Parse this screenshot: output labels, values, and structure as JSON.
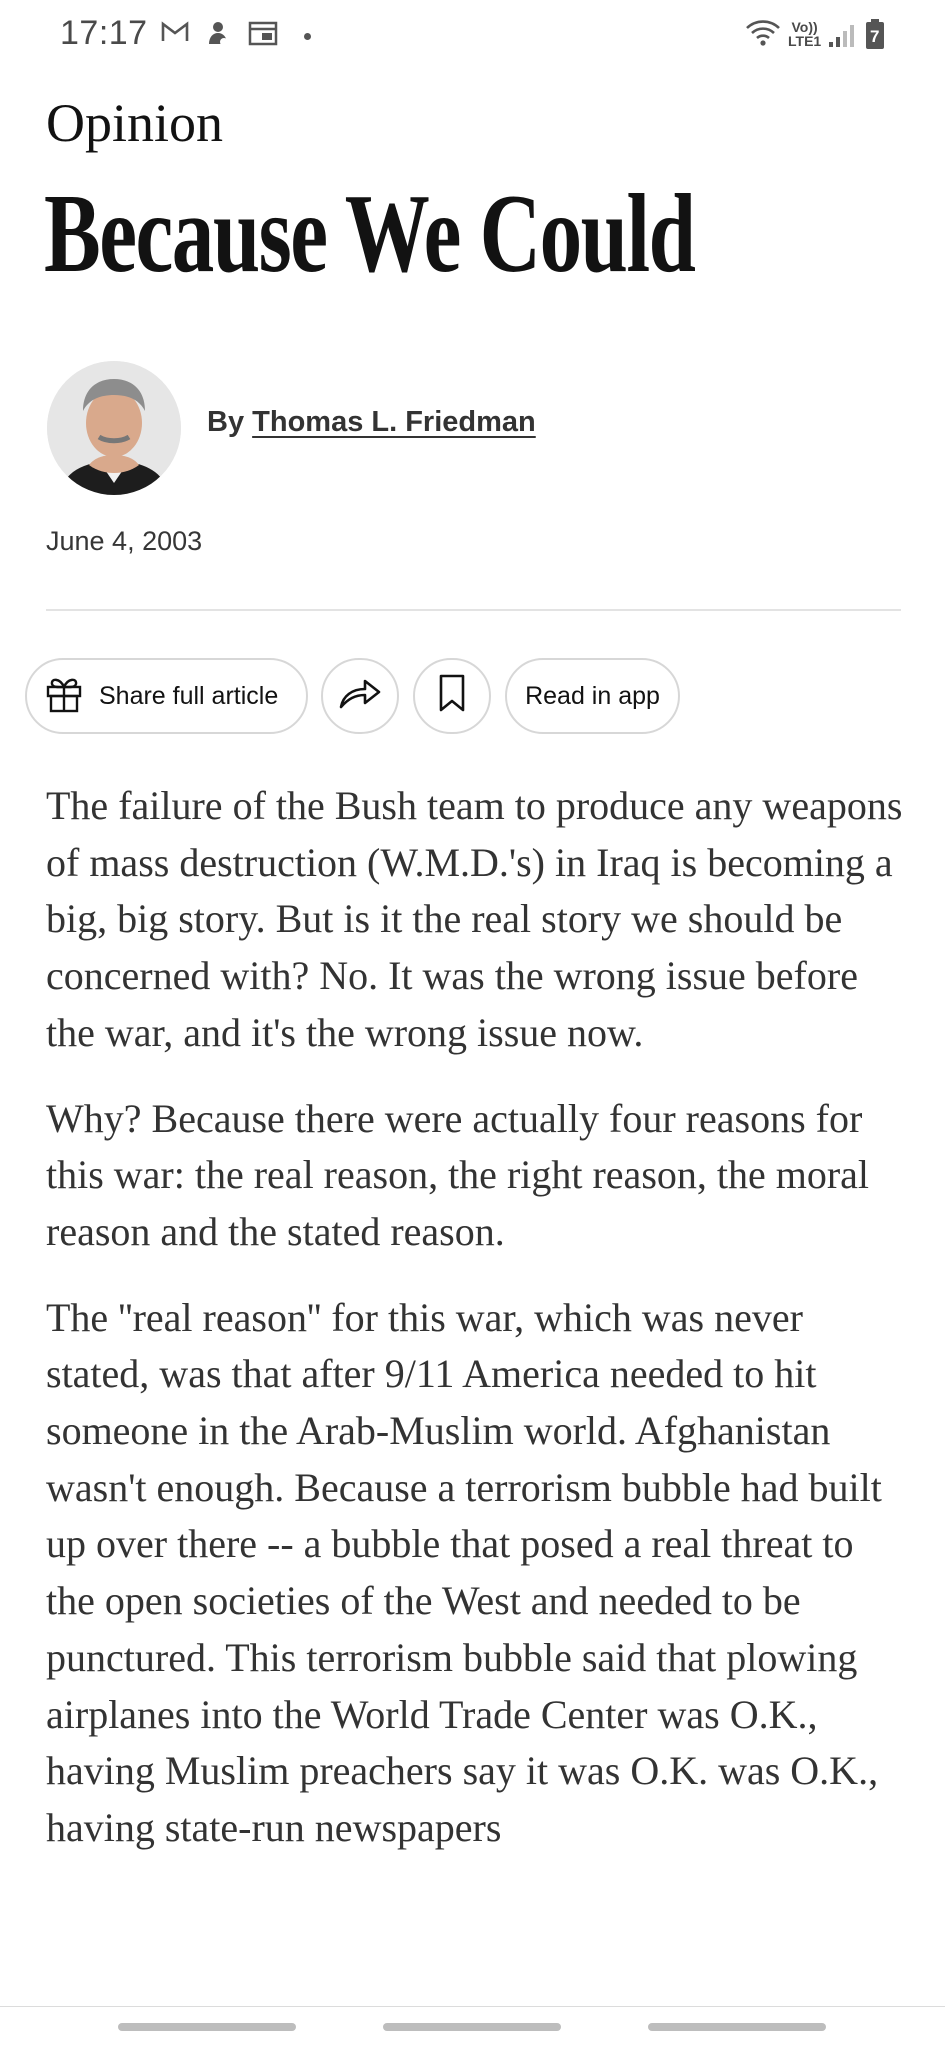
{
  "status_bar": {
    "time": "17:17",
    "lte_line1": "Vo))",
    "lte_line2": "LTE1",
    "battery_level": "7",
    "icons": [
      "gmail-icon",
      "notification-icon",
      "calendar-icon",
      "wifi-icon",
      "signal-icon",
      "battery-icon"
    ]
  },
  "article": {
    "section": "Opinion",
    "headline": "Because We Could",
    "byline_prefix": "By ",
    "author": "Thomas L. Friedman",
    "date": "June 4, 2003",
    "paragraphs": [
      "The failure of the Bush team to produce any weapons of mass destruction (W.M.D.'s) in Iraq is becoming a big, big story. But is it the real story we should be concerned with? No. It was the wrong issue before the war, and it's the wrong issue now.",
      "Why? Because there were actually four reasons for this war: the real reason, the right reason, the moral reason and the stated reason.",
      "The ''real reason'' for this war, which was never stated, was that after 9/11 America needed to hit someone in the Arab-Muslim world. Afghanistan wasn't enough. Because a terrorism bubble had built up over there -- a bubble that posed a real threat to the open societies of the West and needed to be punctured. This terrorism bubble said that plowing airplanes into the World Trade Center was O.K., having Muslim preachers say it was O.K. was O.K., having state-run newspapers"
    ]
  },
  "actions": {
    "share_label": "Share full article",
    "read_in_app_label": "Read in app"
  },
  "colors": {
    "text": "#121212",
    "body_text": "#333333",
    "border": "#d7d7d7"
  }
}
